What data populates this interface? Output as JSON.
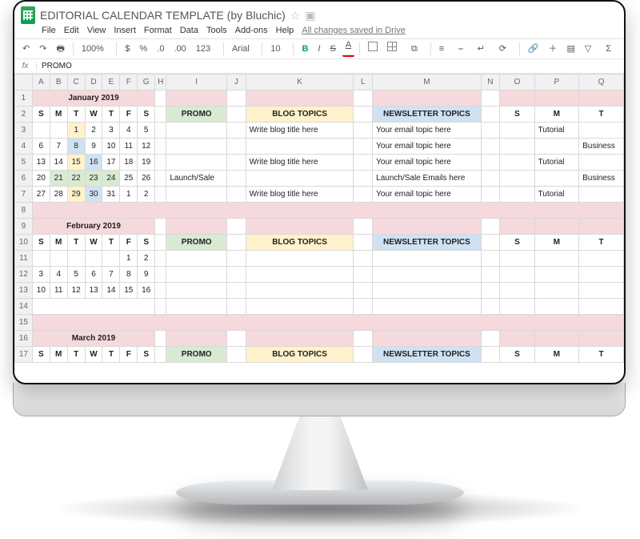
{
  "doc": {
    "title": "EDITORIAL CALENDAR TEMPLATE (by Bluchic)"
  },
  "menu": {
    "file": "File",
    "edit": "Edit",
    "view": "View",
    "insert": "Insert",
    "format": "Format",
    "data": "Data",
    "tools": "Tools",
    "addons": "Add-ons",
    "help": "Help",
    "saved": "All changes saved in Drive"
  },
  "toolbar": {
    "zoom": "100%",
    "currency": "$",
    "percent": "%",
    "dec_dec": ".0",
    "dec_inc": ".00",
    "numfmt": "123",
    "font": "Arial",
    "size": "10",
    "bold": "B",
    "italic": "I",
    "strike": "S",
    "textcolor": "A",
    "halign": "≡",
    "valign": "⎯",
    "wrap": "↵",
    "rotate": "⟳",
    "link": "🔗",
    "comment": "＋",
    "chart": "▤",
    "filter": "▽",
    "sigma": "Σ"
  },
  "fx": {
    "label": "fx",
    "value": "PROMO"
  },
  "cols": [
    "A",
    "B",
    "C",
    "D",
    "E",
    "F",
    "G",
    "H",
    "I",
    "J",
    "K",
    "L",
    "M",
    "N",
    "O",
    "P",
    "Q"
  ],
  "dow": [
    "S",
    "M",
    "T",
    "W",
    "T",
    "F",
    "S"
  ],
  "months": {
    "jan": {
      "title": "January 2019",
      "promo": "PROMO",
      "blog": "BLOG TOPICS",
      "news": "NEWSLETTER TOPICS",
      "weeks": [
        [
          "",
          "",
          "1",
          "2",
          "3",
          "4",
          "5"
        ],
        [
          "6",
          "7",
          "8",
          "9",
          "10",
          "11",
          "12"
        ],
        [
          "13",
          "14",
          "15",
          "16",
          "17",
          "18",
          "19"
        ],
        [
          "20",
          "21",
          "22",
          "23",
          "24",
          "25",
          "26"
        ],
        [
          "27",
          "28",
          "29",
          "30",
          "31",
          "1",
          "2"
        ]
      ],
      "promo_cells": [
        "",
        "",
        "",
        "Launch/Sale",
        ""
      ],
      "blog_cells": [
        "Write blog title here",
        "",
        "Write blog title here",
        "",
        "Write blog title here"
      ],
      "news_cells": [
        "Your email topic here",
        "Your email topic here",
        "Your email topic here",
        "Launch/Sale Emails here",
        "Your email topic here"
      ],
      "right_s": [
        "",
        "",
        "",
        "",
        ""
      ],
      "right_m": [
        "Tutorial",
        "",
        "Tutorial",
        "",
        "Tutorial"
      ],
      "right_t": [
        "",
        "Business",
        "",
        "Business",
        ""
      ]
    },
    "feb": {
      "title": "February 2019",
      "promo": "PROMO",
      "blog": "BLOG TOPICS",
      "news": "NEWSLETTER TOPICS",
      "weeks": [
        [
          "",
          "",
          "",
          "",
          "",
          "1",
          "2"
        ],
        [
          "3",
          "4",
          "5",
          "6",
          "7",
          "8",
          "9"
        ],
        [
          "10",
          "11",
          "12",
          "13",
          "14",
          "15",
          "16"
        ],
        [
          "",
          "",
          "",
          "",
          "",
          "",
          ""
        ],
        [
          "",
          "",
          "",
          "",
          "",
          "",
          ""
        ]
      ]
    },
    "mar": {
      "title": "March 2019",
      "promo": "PROMO",
      "blog": "BLOG TOPICS",
      "news": "NEWSLETTER TOPICS"
    }
  },
  "right_hdr": {
    "s": "S",
    "m": "M",
    "t": "T"
  }
}
